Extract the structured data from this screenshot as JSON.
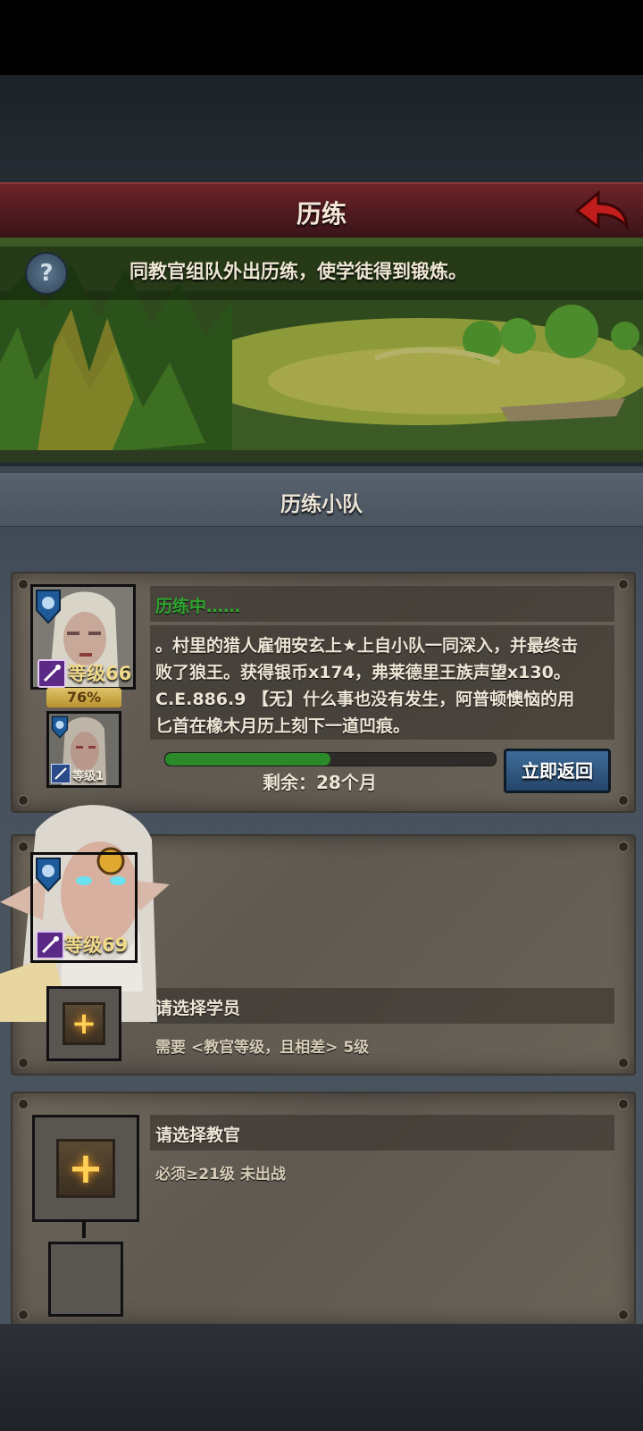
{
  "header": {
    "title": "历练",
    "back_icon": "back-arrow-icon"
  },
  "banner": {
    "description": "同教官组队外出历练，使学徒得到锻炼。",
    "help_icon": "question-icon"
  },
  "section": {
    "title": "历练小队"
  },
  "team1": {
    "status": "历练中……",
    "log_lines": [
      "。村里的猎人雇佣安玄上★上自小队一同深入，并最终击",
      "败了狼王。获得银币x174，弗莱德里王族声望x130。",
      "C.E.886.9 【无】什么事也没有发生，阿普顿懊恼的用",
      "匕首在橡木月历上刻下一道凹痕。"
    ],
    "instructor": {
      "level": "等级66",
      "progress_label": "76%"
    },
    "student": {
      "level": "等级1"
    },
    "progress": 0.5,
    "remaining": "剩余：28个月",
    "return_button": "立即返回"
  },
  "team2": {
    "instructor": {
      "level": "等级69"
    },
    "student_prompt": "请选择学员",
    "requirement": "需要 <教官等级，且相差> 5级"
  },
  "team3": {
    "instructor_prompt": "请选择教官",
    "requirement": "必须≥21级 未出战"
  },
  "colors": {
    "accent_green": "#2a8a2a",
    "gold": "#f1d98a",
    "title_red": "#6e2428"
  }
}
